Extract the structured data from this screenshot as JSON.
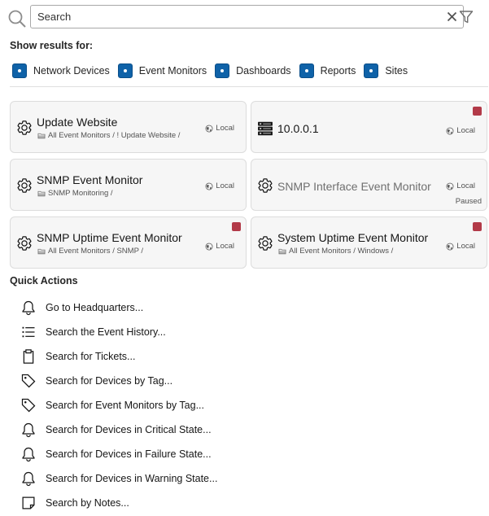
{
  "search": {
    "placeholder": "Search"
  },
  "filters": {
    "heading": "Show results for:",
    "items": [
      {
        "label": "Network Devices",
        "checked": true
      },
      {
        "label": "Event Monitors",
        "checked": true
      },
      {
        "label": "Dashboards",
        "checked": true
      },
      {
        "label": "Reports",
        "checked": true
      },
      {
        "label": "Sites",
        "checked": true
      }
    ]
  },
  "results": [
    {
      "title": "Update Website",
      "icon": "gear-icon",
      "path": "All Event Monitors / ! Update Website /",
      "location": "Local",
      "status": "",
      "paused": ""
    },
    {
      "title": "10.0.0.1",
      "icon": "server-icon",
      "path": "",
      "location": "Local",
      "status": "critical",
      "paused": ""
    },
    {
      "title": "SNMP Event Monitor",
      "icon": "gear-icon",
      "path": "SNMP Monitoring /",
      "location": "Local",
      "status": "",
      "paused": ""
    },
    {
      "title": "SNMP Interface Event Monitor",
      "icon": "gear-icon",
      "path": "",
      "location": "Local",
      "status": "",
      "paused": "Paused"
    },
    {
      "title": "SNMP Uptime Event Monitor",
      "icon": "gear-icon",
      "path": "All Event Monitors / SNMP /",
      "location": "Local",
      "status": "critical",
      "paused": ""
    },
    {
      "title": "System Uptime Event Monitor",
      "icon": "gear-icon",
      "path": "All Event Monitors / Windows /",
      "location": "Local",
      "status": "critical",
      "paused": ""
    }
  ],
  "quick_actions": {
    "heading": "Quick Actions",
    "items": [
      {
        "label": "Go to Headquarters...",
        "icon": "bell-icon"
      },
      {
        "label": "Search the Event History...",
        "icon": "list-icon"
      },
      {
        "label": "Search for Tickets...",
        "icon": "clipboard-icon"
      },
      {
        "label": "Search for Devices by Tag...",
        "icon": "tag-icon"
      },
      {
        "label": "Search for Event Monitors by Tag...",
        "icon": "tag-icon"
      },
      {
        "label": "Search for Devices in Critical State...",
        "icon": "bell-icon"
      },
      {
        "label": "Search for Devices in Failure State...",
        "icon": "bell-icon"
      },
      {
        "label": "Search for Devices in Warning State...",
        "icon": "bell-icon"
      },
      {
        "label": "Search by Notes...",
        "icon": "note-icon"
      }
    ]
  },
  "colors": {
    "checkbox": "#0f62a8",
    "critical": "#b23a48",
    "card_bg": "#f6f6f6"
  }
}
